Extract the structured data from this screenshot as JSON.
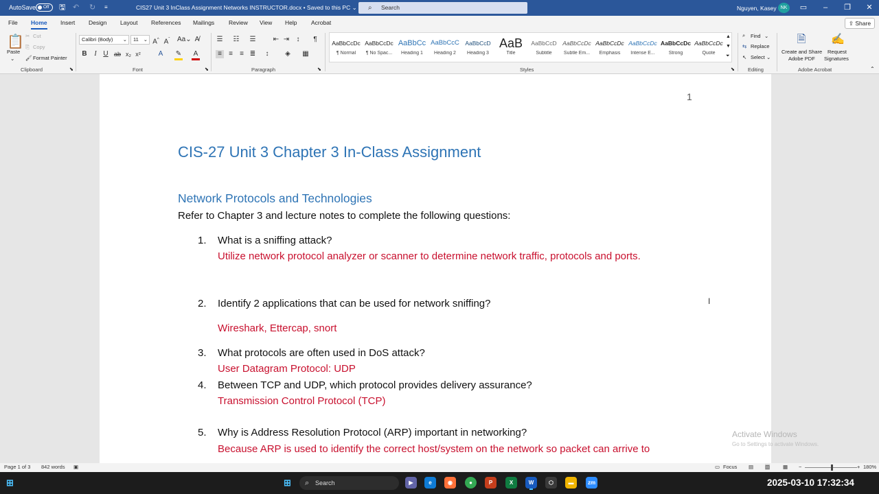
{
  "titlebar": {
    "autosave_label": "AutoSave",
    "autosave_state": "Off",
    "document_title": "CIS27 Unit 3 InClass Assignment Networks INSTRUCTOR.docx  •  Saved to this PC  ⌄",
    "search_placeholder": "Search",
    "user_name": "Nguyen, Kasey",
    "user_initials": "NK"
  },
  "tabs": [
    "File",
    "Home",
    "Insert",
    "Design",
    "Layout",
    "References",
    "Mailings",
    "Review",
    "View",
    "Help",
    "Acrobat"
  ],
  "share_label": "Share",
  "ribbon": {
    "clipboard": {
      "paste": "Paste",
      "cut": "Cut",
      "copy": "Copy",
      "format_painter": "Format Painter",
      "label": "Clipboard"
    },
    "font": {
      "name": "Calibri (Body)",
      "size": "11",
      "label": "Font"
    },
    "paragraph": {
      "label": "Paragraph"
    },
    "styles": {
      "label": "Styles",
      "items": [
        {
          "preview": "AaBbCcDc",
          "name": "¶ Normal"
        },
        {
          "preview": "AaBbCcDc",
          "name": "¶ No Spac..."
        },
        {
          "preview": "AaBbCc",
          "name": "Heading 1"
        },
        {
          "preview": "AaBbCcC",
          "name": "Heading 2"
        },
        {
          "preview": "AaBbCcD",
          "name": "Heading 3"
        },
        {
          "preview": "AaB",
          "name": "Title"
        },
        {
          "preview": "AaBbCcD",
          "name": "Subtitle"
        },
        {
          "preview": "AaBbCcDc",
          "name": "Subtle Em..."
        },
        {
          "preview": "AaBbCcDc",
          "name": "Emphasis"
        },
        {
          "preview": "AaBbCcDc",
          "name": "Intense E..."
        },
        {
          "preview": "AaBbCcDc",
          "name": "Strong"
        },
        {
          "preview": "AaBbCcDc",
          "name": "Quote"
        }
      ]
    },
    "editing": {
      "find": "Find",
      "replace": "Replace",
      "select": "Select",
      "label": "Editing"
    },
    "acrobat": {
      "create_share_1": "Create and Share",
      "create_share_2": "Adobe PDF",
      "request_1": "Request",
      "request_2": "Signatures",
      "label": "Adobe Acrobat"
    }
  },
  "document": {
    "page_number": "1",
    "title": "CIS-27 Unit 3 Chapter 3 In-Class Assignment",
    "heading": "Network Protocols and Technologies",
    "intro": "Refer to Chapter 3 and lecture notes to complete the following questions:",
    "questions": [
      {
        "num": "1.",
        "q": "What is a sniffing attack?",
        "a": "Utilize network protocol analyzer or scanner to determine network traffic, protocols and ports."
      },
      {
        "num": "2.",
        "q": "Identify 2 applications that can be used for network sniffing?",
        "a": "Wireshark, Ettercap, snort"
      },
      {
        "num": "3.",
        "q": "What protocols are often used in DoS attack?",
        "a": "User Datagram Protocol: UDP"
      },
      {
        "num": "4.",
        "q": "Between TCP and UDP, which protocol provides delivery assurance?",
        "a": "Transmission Control Protocol (TCP)"
      },
      {
        "num": "5.",
        "q": "Why is Address Resolution Protocol (ARP) important in networking?",
        "a": "Because ARP is used to identify the correct host/system on the network so packet can arrive to"
      }
    ]
  },
  "watermark": {
    "line1": "Activate Windows",
    "line2": "Go to Settings to activate Windows."
  },
  "statusbar": {
    "page": "Page 1 of 3",
    "words": "842 words",
    "focus": "Focus",
    "zoom": "180%"
  },
  "taskbar": {
    "search_placeholder": "Search",
    "clock": "2025-03-10 17:32:34"
  },
  "colors": {
    "accent": "#2b579a",
    "heading": "#2e74b5",
    "answer": "#c8102e"
  }
}
